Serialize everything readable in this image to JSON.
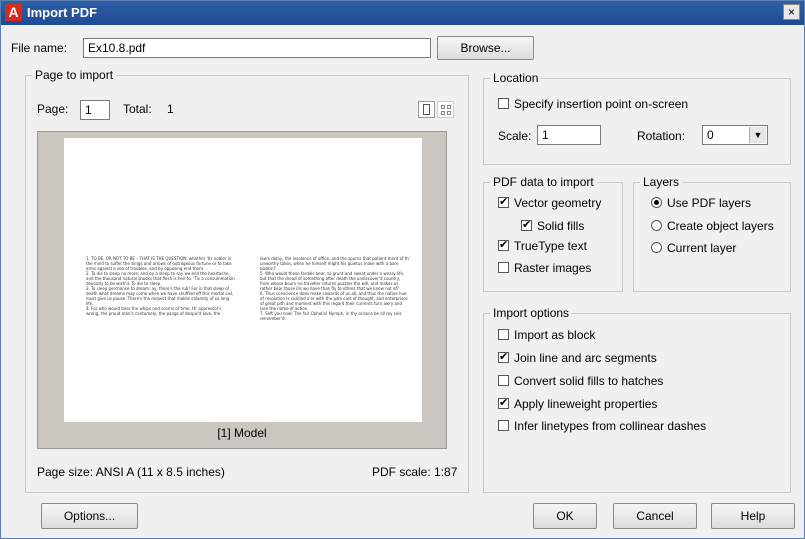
{
  "window": {
    "title": "Import PDF",
    "close": "×"
  },
  "file": {
    "label": "File name:",
    "value": "Ex10.8.pdf",
    "browse": "Browse..."
  },
  "page_to_import": {
    "legend": "Page to import",
    "page_label": "Page:",
    "page_value": "1",
    "total_label": "Total:",
    "total_value": "1",
    "preview_label": "[1] Model",
    "page_size": "Page size: ANSI A (11 x 8.5 inches)",
    "pdf_scale": "PDF scale: 1:87",
    "doc_col1": "1. TO BE, OR NOT TO BE – THAT IS THE QUESTION: whether 'tis nobler in the mind to suffer the slings and arrows of outrageous fortune or to take arms against a sea of troubles, and by opposing end them.\n2. To die to sleep no more; and by a sleep to say we end the heartache, and the thousand natural shocks that flesh is heir to. 'Tis a consummation devoutly to be wish'd. To die to sleep.\n3. To sleep perchance to dream: ay, there's the rub! For in that sleep of death what dreams may come when we have shuffled off this mortal coil, must give us pause. There's the respect that makes calamity of so long life.\n4. For who would bear the whips and scorns of time, th' oppressor's wrong, the proud man's contumely, the pangs of despis'd love, the",
    "doc_col2": "law's delay, the insolence of office, and the spurns that patient merit of th' unworthy takes, when he himself might his quietus make with a bare bodkin?\n5. Who would these fardels bear, to grunt and sweat under a weary life, but that the dread of something after death the undiscover'd country, from whose bourn no traveller returns puzzles the will, and makes us rather bear those ills we have than fly to others that we know not of?\n6. Thus conscience does make cowards of us all, and thus the native hue of resolution is sicklied o'er with the pale cast of thought, and enterprises of great pith and moment with this regard their currents turn awry and lose the name of action.\n7. Soft you now! The fair Ophelia! Nymph, in thy orisons be all my sins remember'd."
  },
  "location": {
    "legend": "Location",
    "specify": "Specify insertion point on-screen",
    "scale_label": "Scale:",
    "scale_value": "1",
    "rotation_label": "Rotation:",
    "rotation_value": "0"
  },
  "pdf_data": {
    "legend": "PDF data to import",
    "vector": "Vector geometry",
    "solid_fills": "Solid fills",
    "truetype": "TrueType text",
    "raster": "Raster images"
  },
  "layers": {
    "legend": "Layers",
    "use_pdf": "Use PDF layers",
    "create_object": "Create object layers",
    "current": "Current layer"
  },
  "import_options": {
    "legend": "Import options",
    "as_block": "Import as block",
    "join": "Join line and arc segments",
    "convert": "Convert solid fills to hatches",
    "lineweight": "Apply lineweight properties",
    "infer": "Infer linetypes from collinear dashes"
  },
  "buttons": {
    "options": "Options...",
    "ok": "OK",
    "cancel": "Cancel",
    "help": "Help"
  },
  "colors": {
    "title_bar": "#1f4a94",
    "app_icon": "#d52b1e",
    "highlight_text": "#d00000"
  }
}
